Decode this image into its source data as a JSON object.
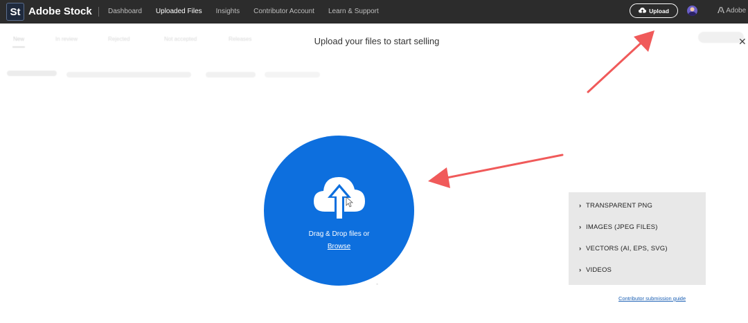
{
  "header": {
    "logo_text": "St",
    "brand": "Adobe Stock",
    "nav": [
      {
        "label": "Dashboard",
        "active": false
      },
      {
        "label": "Uploaded Files",
        "active": true
      },
      {
        "label": "Insights",
        "active": false
      },
      {
        "label": "Contributor Account",
        "active": false
      },
      {
        "label": "Learn & Support",
        "active": false
      }
    ],
    "upload_label": "Upload",
    "adobe_label": "Adobe"
  },
  "background_tabs": [
    "New",
    "In review",
    "Rejected",
    "Not accepted",
    "Releases"
  ],
  "modal": {
    "title": "Upload your files to start selling",
    "close_label": "✕",
    "drop_text": "Drag & Drop files or",
    "browse_label": "Browse"
  },
  "file_types": {
    "items": [
      "TRANSPARENT PNG",
      "IMAGES (JPEG FILES)",
      "VECTORS (AI, EPS, SVG)",
      "VIDEOS"
    ]
  },
  "guide_link": "Contributor submission guide",
  "colors": {
    "topbar": "#2c2c2c",
    "accent_blue": "#0d6fde",
    "annotation_arrow": "#f05a5a",
    "panel_bg": "#e8e8e8"
  },
  "icons": [
    "cloud-upload-icon",
    "close-icon",
    "chevron-right-icon",
    "user-avatar",
    "adobe-logo-icon",
    "annotation-arrow"
  ]
}
